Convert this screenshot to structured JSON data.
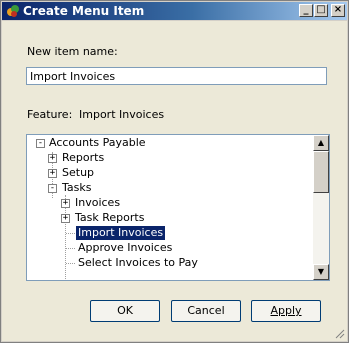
{
  "window": {
    "title": "Create Menu Item"
  },
  "form": {
    "name_label": "New item name:",
    "name_value": "Import Invoices",
    "feature_label": "Feature:",
    "feature_value": "Import Invoices"
  },
  "tree": {
    "items": [
      {
        "label": "Accounts Payable",
        "level": 0,
        "expander": "minus"
      },
      {
        "label": "Reports",
        "level": 1,
        "expander": "plus"
      },
      {
        "label": "Setup",
        "level": 1,
        "expander": "plus"
      },
      {
        "label": "Tasks",
        "level": 1,
        "expander": "minus"
      },
      {
        "label": "Invoices",
        "level": 2,
        "expander": "plus"
      },
      {
        "label": "Task Reports",
        "level": 2,
        "expander": "plus"
      },
      {
        "label": "Import Invoices",
        "level": 2,
        "expander": "none",
        "selected": true
      },
      {
        "label": "Approve Invoices",
        "level": 2,
        "expander": "none"
      },
      {
        "label": "Select Invoices to Pay",
        "level": 2,
        "expander": "none"
      }
    ]
  },
  "buttons": {
    "ok": "OK",
    "cancel": "Cancel",
    "apply": "Apply"
  },
  "icons": {
    "title": "app-icon",
    "minimize": "minimize-icon",
    "maximize": "maximize-icon",
    "close": "close-icon"
  }
}
